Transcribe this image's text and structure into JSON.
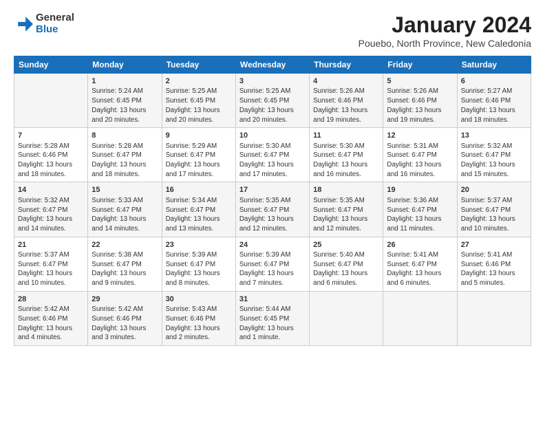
{
  "logo": {
    "general": "General",
    "blue": "Blue"
  },
  "title": "January 2024",
  "subtitle": "Pouebo, North Province, New Caledonia",
  "days_of_week": [
    "Sunday",
    "Monday",
    "Tuesday",
    "Wednesday",
    "Thursday",
    "Friday",
    "Saturday"
  ],
  "weeks": [
    [
      {
        "day": "",
        "info": ""
      },
      {
        "day": "1",
        "info": "Sunrise: 5:24 AM\nSunset: 6:45 PM\nDaylight: 13 hours\nand 20 minutes."
      },
      {
        "day": "2",
        "info": "Sunrise: 5:25 AM\nSunset: 6:45 PM\nDaylight: 13 hours\nand 20 minutes."
      },
      {
        "day": "3",
        "info": "Sunrise: 5:25 AM\nSunset: 6:45 PM\nDaylight: 13 hours\nand 20 minutes."
      },
      {
        "day": "4",
        "info": "Sunrise: 5:26 AM\nSunset: 6:46 PM\nDaylight: 13 hours\nand 19 minutes."
      },
      {
        "day": "5",
        "info": "Sunrise: 5:26 AM\nSunset: 6:46 PM\nDaylight: 13 hours\nand 19 minutes."
      },
      {
        "day": "6",
        "info": "Sunrise: 5:27 AM\nSunset: 6:46 PM\nDaylight: 13 hours\nand 18 minutes."
      }
    ],
    [
      {
        "day": "7",
        "info": "Sunrise: 5:28 AM\nSunset: 6:46 PM\nDaylight: 13 hours\nand 18 minutes."
      },
      {
        "day": "8",
        "info": "Sunrise: 5:28 AM\nSunset: 6:47 PM\nDaylight: 13 hours\nand 18 minutes."
      },
      {
        "day": "9",
        "info": "Sunrise: 5:29 AM\nSunset: 6:47 PM\nDaylight: 13 hours\nand 17 minutes."
      },
      {
        "day": "10",
        "info": "Sunrise: 5:30 AM\nSunset: 6:47 PM\nDaylight: 13 hours\nand 17 minutes."
      },
      {
        "day": "11",
        "info": "Sunrise: 5:30 AM\nSunset: 6:47 PM\nDaylight: 13 hours\nand 16 minutes."
      },
      {
        "day": "12",
        "info": "Sunrise: 5:31 AM\nSunset: 6:47 PM\nDaylight: 13 hours\nand 16 minutes."
      },
      {
        "day": "13",
        "info": "Sunrise: 5:32 AM\nSunset: 6:47 PM\nDaylight: 13 hours\nand 15 minutes."
      }
    ],
    [
      {
        "day": "14",
        "info": "Sunrise: 5:32 AM\nSunset: 6:47 PM\nDaylight: 13 hours\nand 14 minutes."
      },
      {
        "day": "15",
        "info": "Sunrise: 5:33 AM\nSunset: 6:47 PM\nDaylight: 13 hours\nand 14 minutes."
      },
      {
        "day": "16",
        "info": "Sunrise: 5:34 AM\nSunset: 6:47 PM\nDaylight: 13 hours\nand 13 minutes."
      },
      {
        "day": "17",
        "info": "Sunrise: 5:35 AM\nSunset: 6:47 PM\nDaylight: 13 hours\nand 12 minutes."
      },
      {
        "day": "18",
        "info": "Sunrise: 5:35 AM\nSunset: 6:47 PM\nDaylight: 13 hours\nand 12 minutes."
      },
      {
        "day": "19",
        "info": "Sunrise: 5:36 AM\nSunset: 6:47 PM\nDaylight: 13 hours\nand 11 minutes."
      },
      {
        "day": "20",
        "info": "Sunrise: 5:37 AM\nSunset: 6:47 PM\nDaylight: 13 hours\nand 10 minutes."
      }
    ],
    [
      {
        "day": "21",
        "info": "Sunrise: 5:37 AM\nSunset: 6:47 PM\nDaylight: 13 hours\nand 10 minutes."
      },
      {
        "day": "22",
        "info": "Sunrise: 5:38 AM\nSunset: 6:47 PM\nDaylight: 13 hours\nand 9 minutes."
      },
      {
        "day": "23",
        "info": "Sunrise: 5:39 AM\nSunset: 6:47 PM\nDaylight: 13 hours\nand 8 minutes."
      },
      {
        "day": "24",
        "info": "Sunrise: 5:39 AM\nSunset: 6:47 PM\nDaylight: 13 hours\nand 7 minutes."
      },
      {
        "day": "25",
        "info": "Sunrise: 5:40 AM\nSunset: 6:47 PM\nDaylight: 13 hours\nand 6 minutes."
      },
      {
        "day": "26",
        "info": "Sunrise: 5:41 AM\nSunset: 6:47 PM\nDaylight: 13 hours\nand 6 minutes."
      },
      {
        "day": "27",
        "info": "Sunrise: 5:41 AM\nSunset: 6:46 PM\nDaylight: 13 hours\nand 5 minutes."
      }
    ],
    [
      {
        "day": "28",
        "info": "Sunrise: 5:42 AM\nSunset: 6:46 PM\nDaylight: 13 hours\nand 4 minutes."
      },
      {
        "day": "29",
        "info": "Sunrise: 5:42 AM\nSunset: 6:46 PM\nDaylight: 13 hours\nand 3 minutes."
      },
      {
        "day": "30",
        "info": "Sunrise: 5:43 AM\nSunset: 6:46 PM\nDaylight: 13 hours\nand 2 minutes."
      },
      {
        "day": "31",
        "info": "Sunrise: 5:44 AM\nSunset: 6:45 PM\nDaylight: 13 hours\nand 1 minute."
      },
      {
        "day": "",
        "info": ""
      },
      {
        "day": "",
        "info": ""
      },
      {
        "day": "",
        "info": ""
      }
    ]
  ]
}
